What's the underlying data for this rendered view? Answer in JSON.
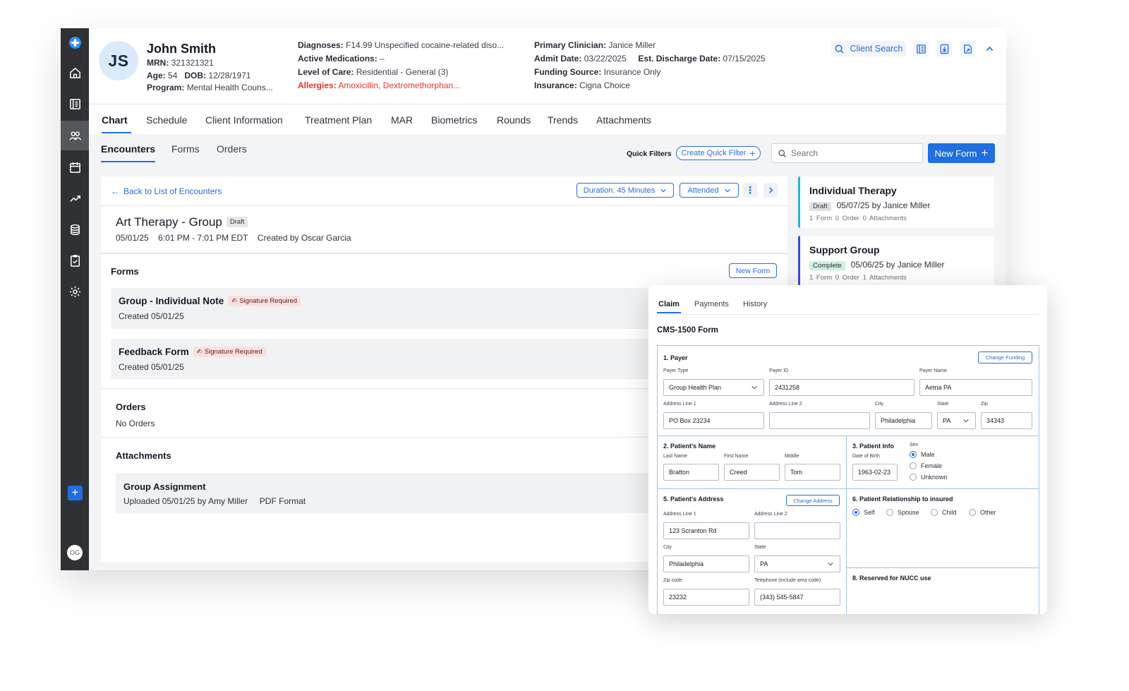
{
  "patient": {
    "initials": "JS",
    "name": "John Smith",
    "mrn_label": "MRN:",
    "mrn": "321321321",
    "age_label": "Age:",
    "age": "54",
    "dob_label": "DOB:",
    "dob": "12/28/1971",
    "program_label": "Program:",
    "program": "Mental Health Couns...",
    "diagnoses_label": "Diagnoses:",
    "diagnoses": "F14.99 Unspecified cocaine-related diso...",
    "medications_label": "Active Medications:",
    "medications": "–",
    "loc_label": "Level of Care:",
    "loc": "Residential - General (3)",
    "allergies_label": "Allergies:",
    "allergies": "Amoxicillin, Dextromethorphan...",
    "clinician_label": "Primary Clinician:",
    "clinician": "Janice Miller",
    "admit_label": "Admit Date:",
    "admit": "03/22/2025",
    "discharge_label": "Est. Discharge Date:",
    "discharge": "07/15/2025",
    "funding_label": "Funding Source:",
    "funding": "Insurance Only",
    "insurance_label": "Insurance:",
    "insurance": "Cigna Choice"
  },
  "header_actions": {
    "client_search": "Client Search"
  },
  "tabs": [
    "Chart",
    "Schedule",
    "Client Information",
    "Treatment Plan",
    "MAR",
    "Biometrics",
    "Rounds",
    "Trends",
    "Attachments"
  ],
  "subtabs": [
    "Encounters",
    "Forms",
    "Orders"
  ],
  "toolbar": {
    "quick_filters": "Quick Filters",
    "create_quick_filter": "Create Quick Filter",
    "search_placeholder": "Search",
    "new_form": "New Form"
  },
  "encounter": {
    "back": "Back to List of Encounters",
    "duration": "Duration: 45 Minutes",
    "attendance": "Attended",
    "title": "Art Therapy - Group",
    "status": "Draft",
    "date": "05/01/25",
    "time": "6:01 PM - 7:01 PM EDT",
    "created_by": "Created by Oscar Garcia",
    "forms_heading": "Forms",
    "new_form_btn": "New Form",
    "forms": [
      {
        "name": "Group - Individual Note",
        "tag": "Signature Required",
        "created": "Created 05/01/25"
      },
      {
        "name": "Feedback Form",
        "tag": "Signature Required",
        "created": "Created 05/01/25"
      }
    ],
    "orders_heading": "Orders",
    "orders_empty": "No Orders",
    "attachments_heading": "Attachments",
    "attachment": {
      "name": "Group Assignment",
      "uploaded": "Uploaded 05/01/25 by Amy Miller",
      "format": "PDF Format"
    }
  },
  "encounter_list": [
    {
      "title": "Individual Therapy",
      "status": "Draft",
      "status_color": "#dfe1e4",
      "line": "05/07/25 by Janice Miller",
      "meta": "1 Form   0 Order   0 Attachments",
      "border": "#22b3d9"
    },
    {
      "title": "Support Group",
      "status": "Complete",
      "status_color": "#cdf1df",
      "line": "05/06/25 by Janice Miller",
      "meta": "1 Form   0 Order   1 Attachments",
      "border": "#3d4bd1"
    }
  ],
  "sidebar": {
    "user_initials": "OG"
  },
  "claim": {
    "tabs": [
      "Claim",
      "Payments",
      "History"
    ],
    "form_title": "CMS-1500 Form",
    "payer": {
      "heading": "1. Payer",
      "change_btn": "Change Funding",
      "payer_type_label": "Payer Type",
      "payer_type": "Group Health Plan",
      "payer_id_label": "Payer ID",
      "payer_id": "2431258",
      "payer_name_label": "Payer Name",
      "payer_name": "Aetna PA",
      "addr1_label": "Address Line 1",
      "addr1": "PO Box 23234",
      "addr2_label": "Address Line 2",
      "addr2": "",
      "city_label": "City",
      "city": "Philadelphia",
      "state_label": "State",
      "state": "PA",
      "zip_label": "Zip",
      "zip": "34343"
    },
    "patient_name": {
      "heading": "2. Patient's Name",
      "last_label": "Last Name",
      "last": "Bratton",
      "first_label": "First Name",
      "first": "Creed",
      "middle_label": "Middle",
      "middle": "Tom"
    },
    "patient_info": {
      "heading": "3. Patient Info",
      "dob_label": "Date of Birth",
      "dob": "1963-02-23",
      "sex_label": "Sex",
      "sex_options": [
        "Male",
        "Female",
        "Unknown"
      ],
      "sex_selected": "Male"
    },
    "patient_address": {
      "heading": "5. Patient's Address",
      "change_btn": "Change Address",
      "addr1_label": "Address Line 1",
      "addr1": "123 Scranton Rd",
      "addr2_label": "Address Line 2",
      "addr2": "",
      "city_label": "City",
      "city": "Philadelphia",
      "state_label": "State",
      "state": "PA",
      "zip_label": "Zip code",
      "zip": "23232",
      "phone_label": "Telephone (include area code)",
      "phone": "(343) 545-5847"
    },
    "relationship": {
      "heading": "6. Patient Relationship to insured",
      "options": [
        "Self",
        "Spouse",
        "Child",
        "Other"
      ],
      "selected": "Self"
    },
    "reserved": {
      "heading": "8. Reserved for NUCC use"
    }
  },
  "colors": {
    "accent": "#1f6fe0",
    "sidebar": "#2f3134",
    "danger": "#e0362e"
  }
}
